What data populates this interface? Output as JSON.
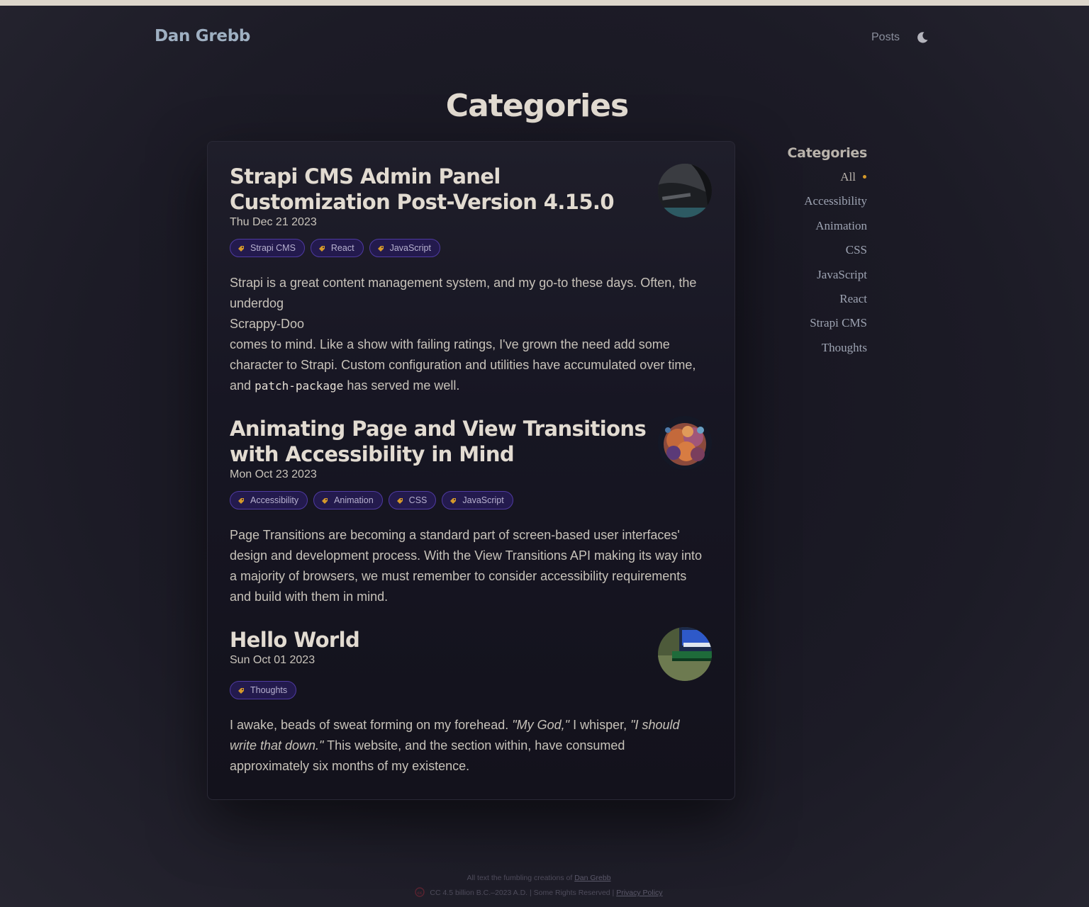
{
  "header": {
    "brand": "Dan Grebb",
    "nav": {
      "posts": "Posts"
    },
    "theme_icon": "moon-icon"
  },
  "page": {
    "title": "Categories"
  },
  "posts": [
    {
      "title": "Strapi CMS Admin Panel Customization Post-Version 4.15.0",
      "date": "Thu Dec 21 2023",
      "tags": [
        "Strapi CMS",
        "React",
        "JavaScript"
      ],
      "excerpt": {
        "p1": "Strapi is a great content management system, and my go-to these days. Often, the underdog",
        "p2": "Scrappy-Doo",
        "p3": "comes to mind. Like a show with failing ratings, I've grown the need add some character to Strapi. Custom configuration and utilities have accumulated over time, and",
        "code": "patch-package",
        "p4": "has served me well."
      }
    },
    {
      "title": "Animating Page and View Transitions with Accessibility in Mind",
      "date": "Mon Oct 23 2023",
      "tags": [
        "Accessibility",
        "Animation",
        "CSS",
        "JavaScript"
      ],
      "excerpt": "Page Transitions are becoming a standard part of screen-based user interfaces' design and development process. With the View Transitions API making its way into a majority of browsers, we must remember to consider accessibility requirements and build with them in mind."
    },
    {
      "title": "Hello World",
      "date": "Sun Oct 01 2023",
      "tags": [
        "Thoughts"
      ],
      "excerpt": {
        "p1": "I awake, beads of sweat forming on my forehead.",
        "em1": "\"My God,\"",
        "p2": "I whisper,",
        "em2": "\"I should write that down.\"",
        "p3": "This website, and the section within, have consumed approximately six months of my existence."
      }
    }
  ],
  "sidebar": {
    "title": "Categories",
    "items": [
      "All",
      "Accessibility",
      "Animation",
      "CSS",
      "JavaScript",
      "React",
      "Strapi CMS",
      "Thoughts"
    ],
    "active": "All",
    "accent": "#d69a2a"
  },
  "footer": {
    "line1_prefix": "All text the fumbling creations of",
    "line1_link": "Dan Grebb",
    "line2_text": "CC 4.5 billion B.C.–2023 A.D. | Some Rights Reserved |",
    "line2_link": "Privacy Policy",
    "cc_icon": "creative-commons-icon"
  },
  "colors": {
    "tag_border": "#4f3aa2",
    "tag_bg": "#231a4d",
    "tag_icon": "#d69a2a"
  }
}
